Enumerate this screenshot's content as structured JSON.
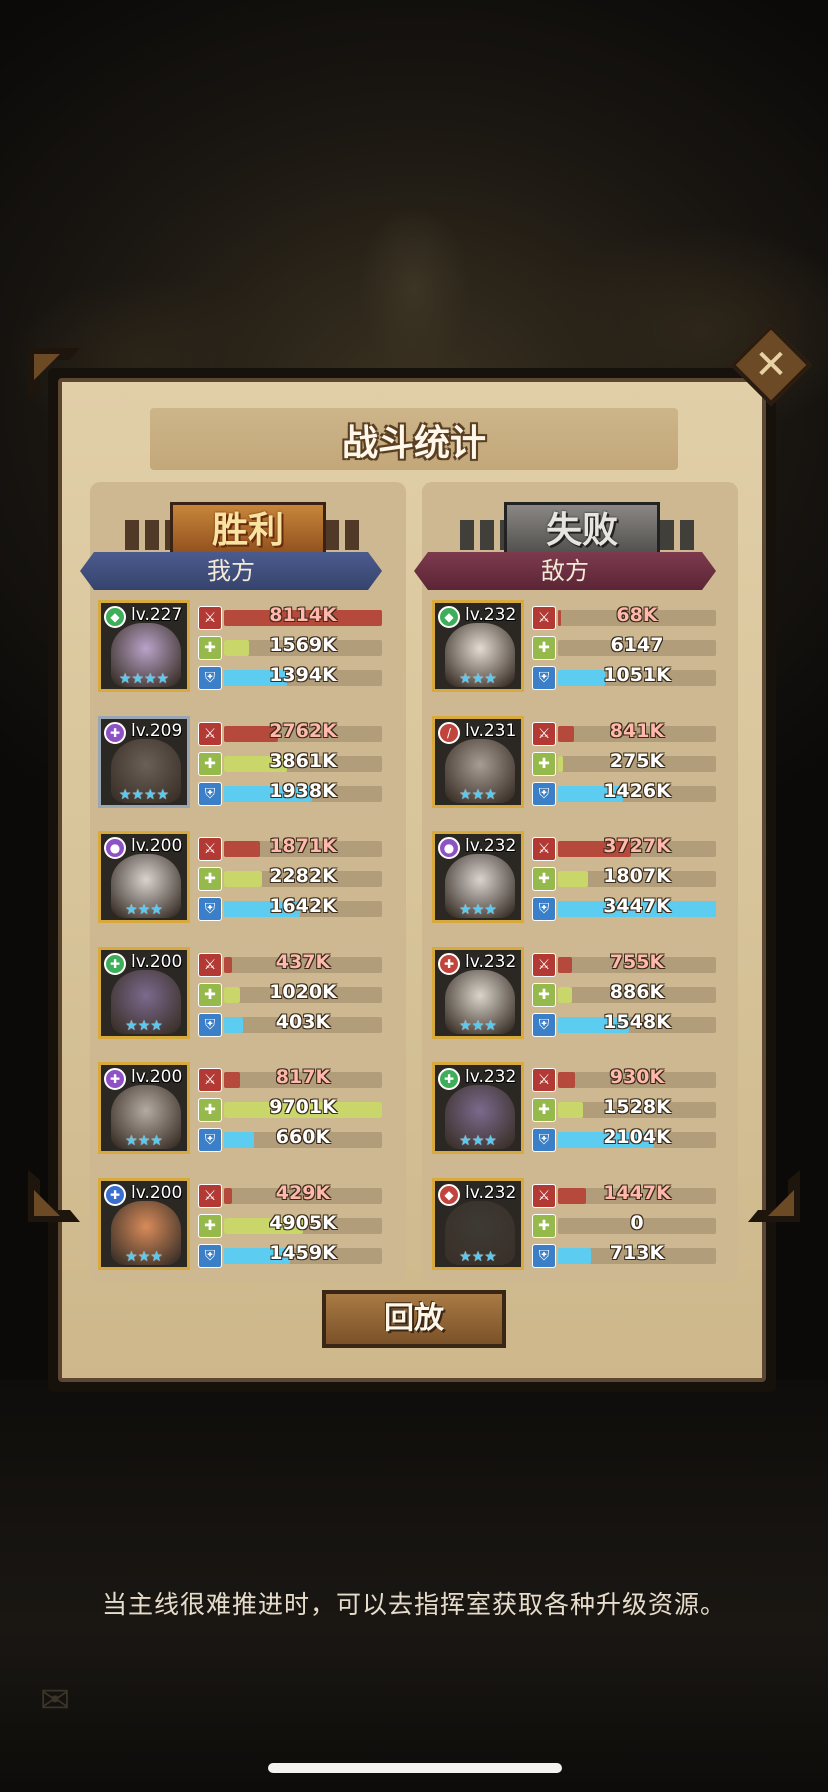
{
  "title": "战斗统计",
  "close_label": "✕",
  "left": {
    "result": "胜利",
    "side": "我方",
    "heroes": [
      {
        "level": "lv.227",
        "element_color": "#3fae5a",
        "element_glyph": "◆",
        "face": "#b9a3c9",
        "frame": "gold",
        "stars": "★★★★",
        "atk": "8114K",
        "atk_pct": 1.0,
        "heal": "1569K",
        "heal_pct": 0.16,
        "def": "1394K",
        "def_pct": 0.4
      },
      {
        "level": "lv.209",
        "element_color": "#8f52c4",
        "element_glyph": "✚",
        "face": "#6b6058",
        "frame": "silver",
        "stars": "★★★★",
        "atk": "2762K",
        "atk_pct": 0.34,
        "heal": "3861K",
        "heal_pct": 0.4,
        "def": "1938K",
        "def_pct": 0.56
      },
      {
        "level": "lv.200",
        "element_color": "#8f52c4",
        "element_glyph": "●",
        "face": "#d9d3cf",
        "frame": "gold",
        "stars": "★★★",
        "atk": "1871K",
        "atk_pct": 0.23,
        "heal": "2282K",
        "heal_pct": 0.24,
        "def": "1642K",
        "def_pct": 0.48
      },
      {
        "level": "lv.200",
        "element_color": "#3fae5a",
        "element_glyph": "✚",
        "face": "#7b6a8e",
        "frame": "gold",
        "stars": "★★★",
        "atk": "437K",
        "atk_pct": 0.05,
        "heal": "1020K",
        "heal_pct": 0.1,
        "def": "403K",
        "def_pct": 0.12
      },
      {
        "level": "lv.200",
        "element_color": "#8f52c4",
        "element_glyph": "✚",
        "face": "#b4aba3",
        "frame": "gold",
        "stars": "★★★",
        "atk": "817K",
        "atk_pct": 0.1,
        "heal": "9701K",
        "heal_pct": 1.0,
        "def": "660K",
        "def_pct": 0.19
      },
      {
        "level": "lv.200",
        "element_color": "#3a6fd0",
        "element_glyph": "✚",
        "face": "#d98b5a",
        "frame": "gold",
        "stars": "★★★",
        "atk": "429K",
        "atk_pct": 0.05,
        "heal": "4905K",
        "heal_pct": 0.5,
        "def": "1459K",
        "def_pct": 0.42
      }
    ]
  },
  "right": {
    "result": "失败",
    "side": "敌方",
    "heroes": [
      {
        "level": "lv.232",
        "element_color": "#3fae5a",
        "element_glyph": "◆",
        "face": "#e4dcd2",
        "frame": "gold",
        "stars": "★★★",
        "atk": "68K",
        "atk_pct": 0.02,
        "heal": "6147",
        "heal_pct": 0.0,
        "def": "1051K",
        "def_pct": 0.3
      },
      {
        "level": "lv.231",
        "element_color": "#c1453c",
        "element_glyph": "/",
        "face": "#a79d94",
        "frame": "gold",
        "stars": "★★★",
        "atk": "841K",
        "atk_pct": 0.1,
        "heal": "275K",
        "heal_pct": 0.03,
        "def": "1426K",
        "def_pct": 0.41
      },
      {
        "level": "lv.232",
        "element_color": "#8f52c4",
        "element_glyph": "●",
        "face": "#d9d3cf",
        "frame": "gold",
        "stars": "★★★",
        "atk": "3727K",
        "atk_pct": 0.46,
        "heal": "1807K",
        "heal_pct": 0.19,
        "def": "3447K",
        "def_pct": 1.0
      },
      {
        "level": "lv.232",
        "element_color": "#c1453c",
        "element_glyph": "✚",
        "face": "#dad5cc",
        "frame": "gold",
        "stars": "★★★",
        "atk": "755K",
        "atk_pct": 0.09,
        "heal": "886K",
        "heal_pct": 0.09,
        "def": "1548K",
        "def_pct": 0.45
      },
      {
        "level": "lv.232",
        "element_color": "#3fae5a",
        "element_glyph": "✚",
        "face": "#7b6a8e",
        "frame": "gold",
        "stars": "★★★",
        "atk": "930K",
        "atk_pct": 0.11,
        "heal": "1528K",
        "heal_pct": 0.16,
        "def": "2104K",
        "def_pct": 0.61
      },
      {
        "level": "lv.232",
        "element_color": "#c1453c",
        "element_glyph": "◆",
        "face": "#3d3a35",
        "frame": "gold",
        "stars": "★★★",
        "atk": "1447K",
        "atk_pct": 0.18,
        "heal": "0",
        "heal_pct": 0.0,
        "def": "713K",
        "def_pct": 0.21
      }
    ]
  },
  "replay_label": "回放",
  "hint": "当主线很难推进时，可以去指挥室获取各种升级资源。"
}
